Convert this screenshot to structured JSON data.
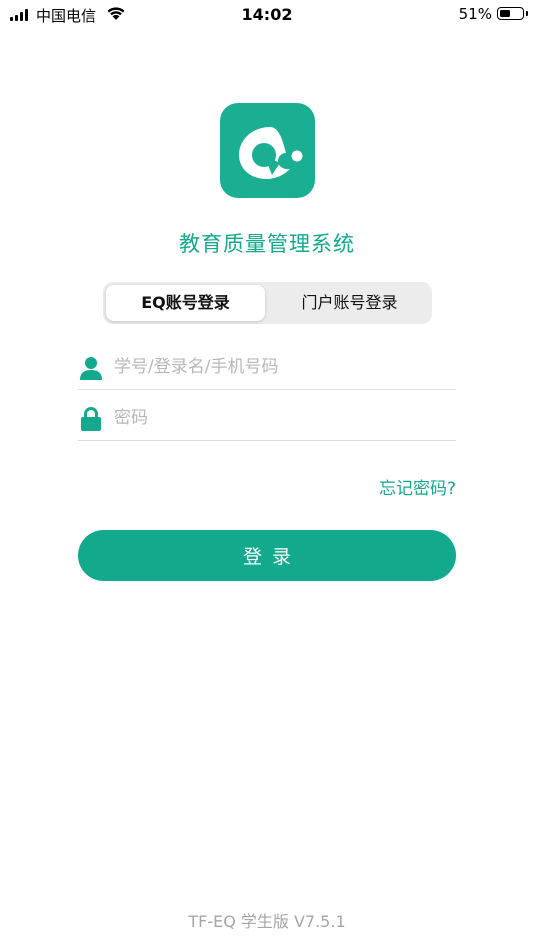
{
  "status_bar": {
    "carrier": "中国电信",
    "time": "14:02",
    "battery_percent_label": "51%",
    "battery_level": 0.51,
    "icons": [
      "signal-bars-icon",
      "wifi-icon",
      "battery-icon"
    ]
  },
  "app": {
    "logo_icon": "eq-logo-icon",
    "title": "教育质量管理系统"
  },
  "login_tabs": [
    {
      "label": "EQ账号登录",
      "selected": true
    },
    {
      "label": "门户账号登录",
      "selected": false
    }
  ],
  "form": {
    "username": {
      "placeholder": "学号/登录名/手机号码",
      "value": "",
      "icon": "user-icon"
    },
    "password": {
      "placeholder": "密码",
      "value": "",
      "icon": "lock-icon"
    },
    "forgot_password": "忘记密码?",
    "submit_label": "登录"
  },
  "footer": {
    "version": "TF-EQ 学生版 V7.5.1"
  },
  "colors": {
    "accent": "#12a98d",
    "placeholder": "#b7b7b7",
    "segment_bg": "#ececec"
  }
}
